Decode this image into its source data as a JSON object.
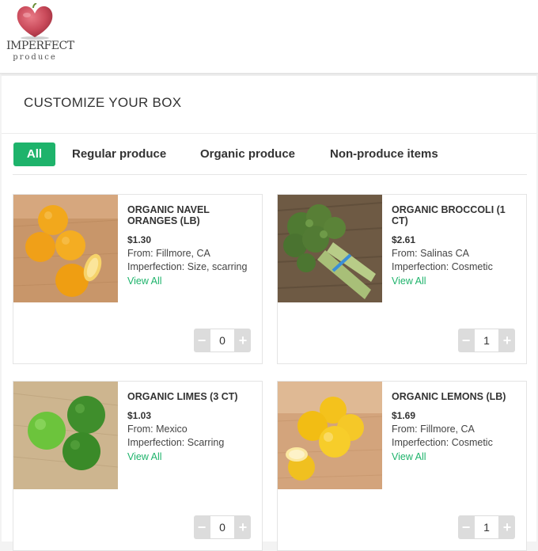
{
  "brand": {
    "logo_word": "IMPERFECT",
    "logo_sub": "produce",
    "heart_color": "#c94a5a"
  },
  "page": {
    "title": "CUSTOMIZE YOUR BOX"
  },
  "tabs": [
    {
      "label": "All",
      "active": true
    },
    {
      "label": "Regular produce",
      "active": false
    },
    {
      "label": "Organic produce",
      "active": false
    },
    {
      "label": "Non-produce items",
      "active": false
    }
  ],
  "products": [
    {
      "name": "ORGANIC NAVEL ORANGES (LB)",
      "price": "$1.30",
      "origin": "From: Fillmore, CA",
      "imperfection": "Imperfection: Size, scarring",
      "link": "View All",
      "quantity": "0",
      "image": "oranges"
    },
    {
      "name": "ORGANIC BROCCOLI (1 CT)",
      "price": "$2.61",
      "origin": "From: Salinas CA",
      "imperfection": "Imperfection: Cosmetic",
      "link": "View All",
      "quantity": "1",
      "image": "broccoli"
    },
    {
      "name": "ORGANIC LIMES (3 CT)",
      "price": "$1.03",
      "origin": "From: Mexico",
      "imperfection": "Imperfection: Scarring",
      "link": "View All",
      "quantity": "0",
      "image": "limes"
    },
    {
      "name": "ORGANIC LEMONS (LB)",
      "price": "$1.69",
      "origin": "From: Fillmore, CA",
      "imperfection": "Imperfection: Cosmetic",
      "link": "View All",
      "quantity": "1",
      "image": "lemons"
    }
  ],
  "stepper": {
    "minus_symbol": "−",
    "plus_symbol": "+"
  },
  "colors": {
    "accent": "#1eb36b",
    "stepper_bg": "#dcdcdc"
  }
}
